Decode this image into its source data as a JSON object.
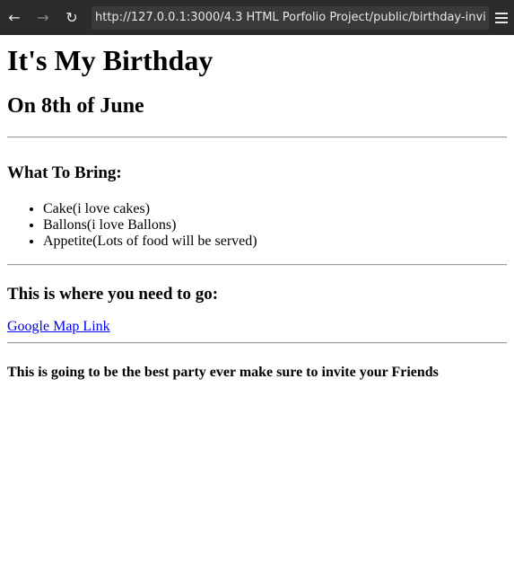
{
  "browser": {
    "back_icon": "←",
    "forward_icon": "→",
    "reload_icon": "↻",
    "url": "http://127.0.0.1:3000/4.3 HTML Porfolio Project/public/birthday-invite.htm"
  },
  "page": {
    "title": "It's My Birthday",
    "date_heading": "On 8th of June",
    "bring_heading": "What To Bring:",
    "bring_items": [
      "Cake(i love cakes)",
      "Ballons(i love Ballons)",
      "Appetite(Lots of food will be served)"
    ],
    "location_heading": "This is where you need to go:",
    "map_link": "Google Map Link",
    "footer_note": "This is going to be the best party ever make sure to invite your Friends"
  }
}
